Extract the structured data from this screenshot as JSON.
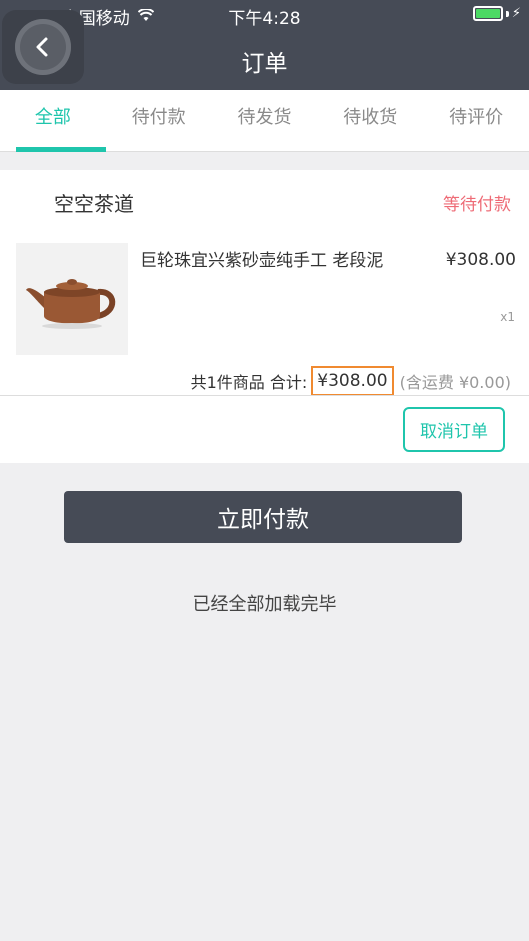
{
  "status_bar": {
    "carrier": "中国移动",
    "time": "下午4:28"
  },
  "header": {
    "title": "订单",
    "back_icon": "chevron-left-icon"
  },
  "tabs": [
    {
      "label": "全部",
      "active": true
    },
    {
      "label": "待付款",
      "active": false
    },
    {
      "label": "待发货",
      "active": false
    },
    {
      "label": "待收货",
      "active": false
    },
    {
      "label": "待评价",
      "active": false
    }
  ],
  "order": {
    "shop_name": "空空茶道",
    "status": "等待付款",
    "product": {
      "name": "巨轮珠宜兴紫砂壶纯手工 老段泥",
      "price": "¥308.00",
      "quantity": "x1"
    },
    "summary": {
      "count_text": "共1件商品 合计:",
      "total": "¥308.00",
      "shipping": "(含运费 ¥0.00)"
    },
    "cancel_label": "取消订单"
  },
  "pay_button": "立即付款",
  "load_complete": "已经全部加载完毕",
  "colors": {
    "accent": "#1fc5ac",
    "header_bg": "#464b56",
    "status_pending": "#ee6b76",
    "highlight_border": "#f08a30"
  }
}
